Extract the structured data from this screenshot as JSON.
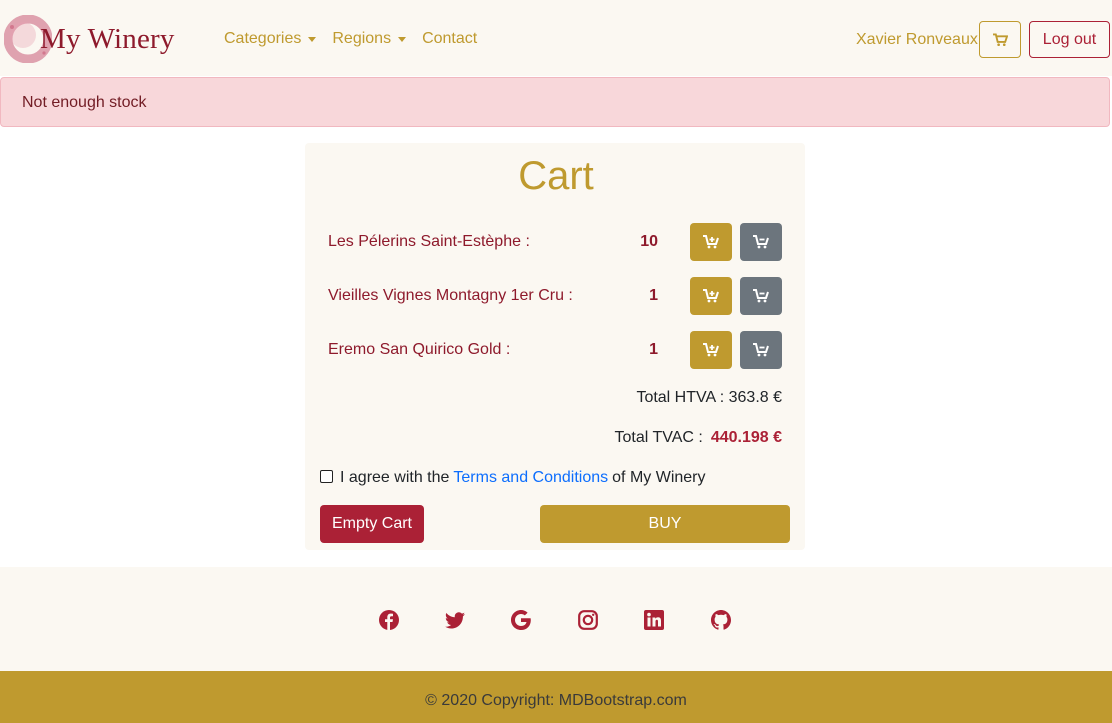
{
  "navbar": {
    "brand": "My Winery",
    "links": [
      {
        "label": "Categories"
      },
      {
        "label": "Regions"
      },
      {
        "label": "Contact"
      }
    ],
    "user_name": "Xavier Ronveaux",
    "logout_label": "Log out"
  },
  "alert": {
    "message": "Not enough stock"
  },
  "cart": {
    "title": "Cart",
    "items": [
      {
        "name": "Les Pélerins Saint-Estèphe :",
        "qty": "10"
      },
      {
        "name": "Vieilles Vignes Montagny 1er Cru :",
        "qty": "1"
      },
      {
        "name": "Eremo San Quirico Gold :",
        "qty": "1"
      }
    ],
    "total_htva": "Total HTVA : 363.8 €",
    "total_tvac_label": "Total TVAC :",
    "total_tvac_value": "440.198 €",
    "terms_prefix": "I agree with the",
    "terms_link": "Terms and Conditions",
    "terms_suffix": "of My Winery",
    "empty_label": "Empty Cart",
    "buy_label": "BUY"
  },
  "footer": {
    "social_icons": [
      "facebook-icon",
      "twitter-icon",
      "google-icon",
      "instagram-icon",
      "linkedin-icon",
      "github-icon"
    ],
    "copyright": "© 2020 Copyright: MDBootstrap.com"
  },
  "colors": {
    "gold": "#bf9a2f",
    "wine": "#8e1a2c",
    "red": "#ab2136",
    "grey": "#6c757d",
    "cream": "#fbf8f2",
    "alert_bg": "#f8d7da"
  }
}
